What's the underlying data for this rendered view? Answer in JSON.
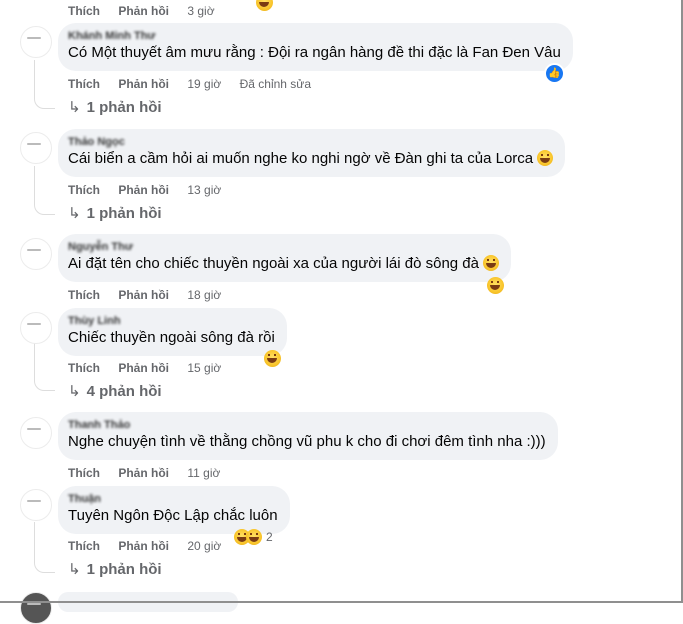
{
  "labels": {
    "like": "Thích",
    "reply": "Phản hồi",
    "edited": "Đã chỉnh sửa"
  },
  "top_row": {
    "time": "3 giờ"
  },
  "comments": [
    {
      "author": "Khánh Minh Thư",
      "text": "Có Một thuyết âm mưu rằng : Đội ra ngân hàng đề thi đặc là Fan Đen Vâu",
      "time": "19 giờ",
      "replies": "1 phản hồi",
      "reaction": "like-icon"
    },
    {
      "author": "Thảo Ngọc",
      "text": "Cái biển a cầm hỏi ai muốn nghe ko nghi ngờ về Đàn ghi ta của Lorca",
      "time": "13 giờ",
      "replies": "1 phản hồi",
      "inline_emoji": "laughing-emoji-icon"
    },
    {
      "author": "Nguyễn Thư",
      "text": "Ai đặt tên cho chiếc thuyền ngoài xa của người lái đò sông đà",
      "time": "18 giờ",
      "inline_emoji": "laughing-emoji-icon",
      "reaction": "haha-icon"
    },
    {
      "author": "Thùy Linh",
      "text": "Chiếc thuyền ngoài sông đà rồi",
      "time": "15 giờ",
      "replies": "4 phản hồi",
      "reaction": "haha-icon"
    },
    {
      "author": "Thanh Thảo",
      "text": "Nghe chuyện tình về thằng chồng vũ phu k cho đi chơi đêm tình nha :)))",
      "time": "11 giờ"
    },
    {
      "author": "Thuận",
      "text": "Tuyên Ngôn Độc Lập chắc luôn",
      "time": "20 giờ",
      "replies": "1 phản hồi",
      "reaction_count": "2"
    }
  ],
  "colors": {
    "bubble": "#f0f2f5",
    "meta": "#65676b",
    "like_blue": "#1877f2"
  }
}
